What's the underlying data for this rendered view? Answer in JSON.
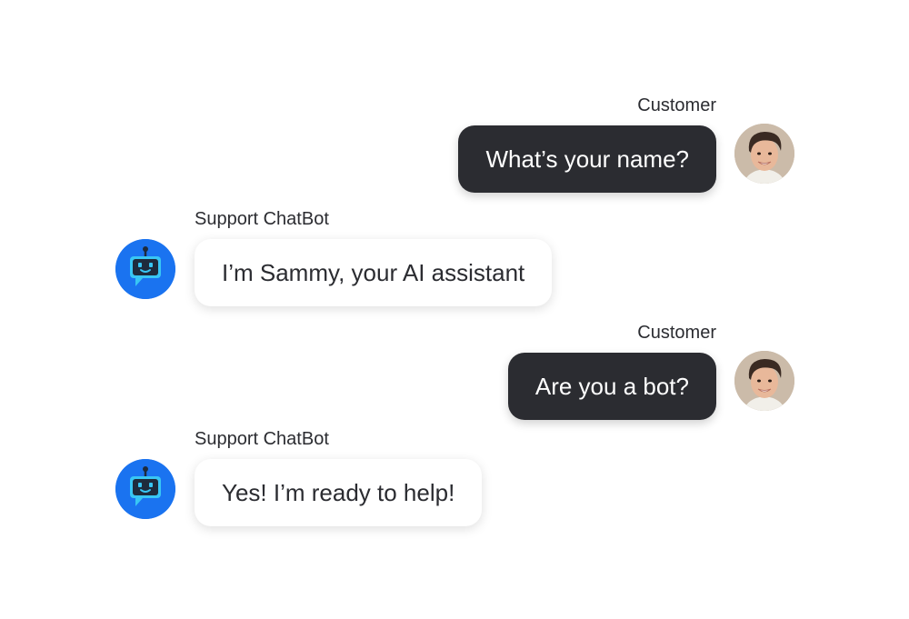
{
  "conversation": {
    "messages": [
      {
        "sender": "Customer",
        "text": "What’s your name?",
        "avatar_icon": "customer-face-icon"
      },
      {
        "sender": "Support ChatBot",
        "text": "I’m Sammy, your AI assistant",
        "avatar_icon": "robot-chatbot-icon"
      },
      {
        "sender": "Customer",
        "text": "Are you a bot?",
        "avatar_icon": "customer-face-icon"
      },
      {
        "sender": "Support ChatBot",
        "text": "Yes! I’m ready to help!",
        "avatar_icon": "robot-chatbot-icon"
      }
    ]
  },
  "colors": {
    "customer_bubble": "#2b2c31",
    "bot_bubble": "#ffffff",
    "bot_avatar": "#1a73f0",
    "label_text": "#2b2c31"
  }
}
